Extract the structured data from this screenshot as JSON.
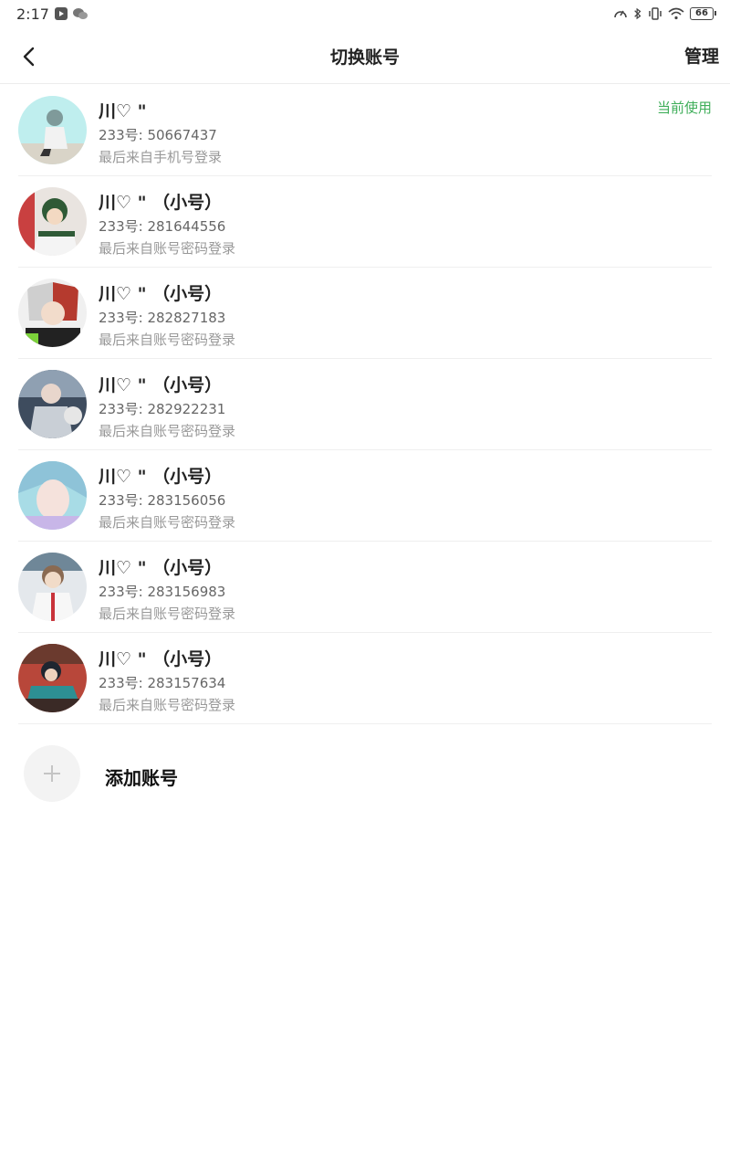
{
  "status_bar": {
    "time": "2:17",
    "battery": "66",
    "icons": [
      "video-app-icon",
      "wechat-icon",
      "speed-icon",
      "bluetooth-icon",
      "vibrate-icon",
      "wifi-icon",
      "battery-icon"
    ]
  },
  "nav": {
    "title": "切换账号",
    "manage": "管理",
    "back_icon": "chevron-left-icon"
  },
  "accounts": [
    {
      "name": "川♡ \"",
      "id": "233号: 50667437",
      "login": "最后来自手机号登录",
      "current": "当前使用"
    },
    {
      "name": "川♡ \" （小号）",
      "id": "233号: 281644556",
      "login": "最后来自账号密码登录"
    },
    {
      "name": "川♡ \" （小号）",
      "id": "233号: 282827183",
      "login": "最后来自账号密码登录"
    },
    {
      "name": "川♡ \" （小号）",
      "id": "233号: 282922231",
      "login": "最后来自账号密码登录"
    },
    {
      "name": "川♡ \" （小号）",
      "id": "233号: 283156056",
      "login": "最后来自账号密码登录"
    },
    {
      "name": "川♡ \" （小号）",
      "id": "233号: 283156983",
      "login": "最后来自账号密码登录"
    },
    {
      "name": "川♡ \" （小号）",
      "id": "233号: 283157634",
      "login": "最后来自账号密码登录"
    }
  ],
  "add_account": {
    "label": "添加账号",
    "icon": "plus-icon"
  },
  "colors": {
    "current_badge": "#3fae5a",
    "divider": "#efefef"
  }
}
